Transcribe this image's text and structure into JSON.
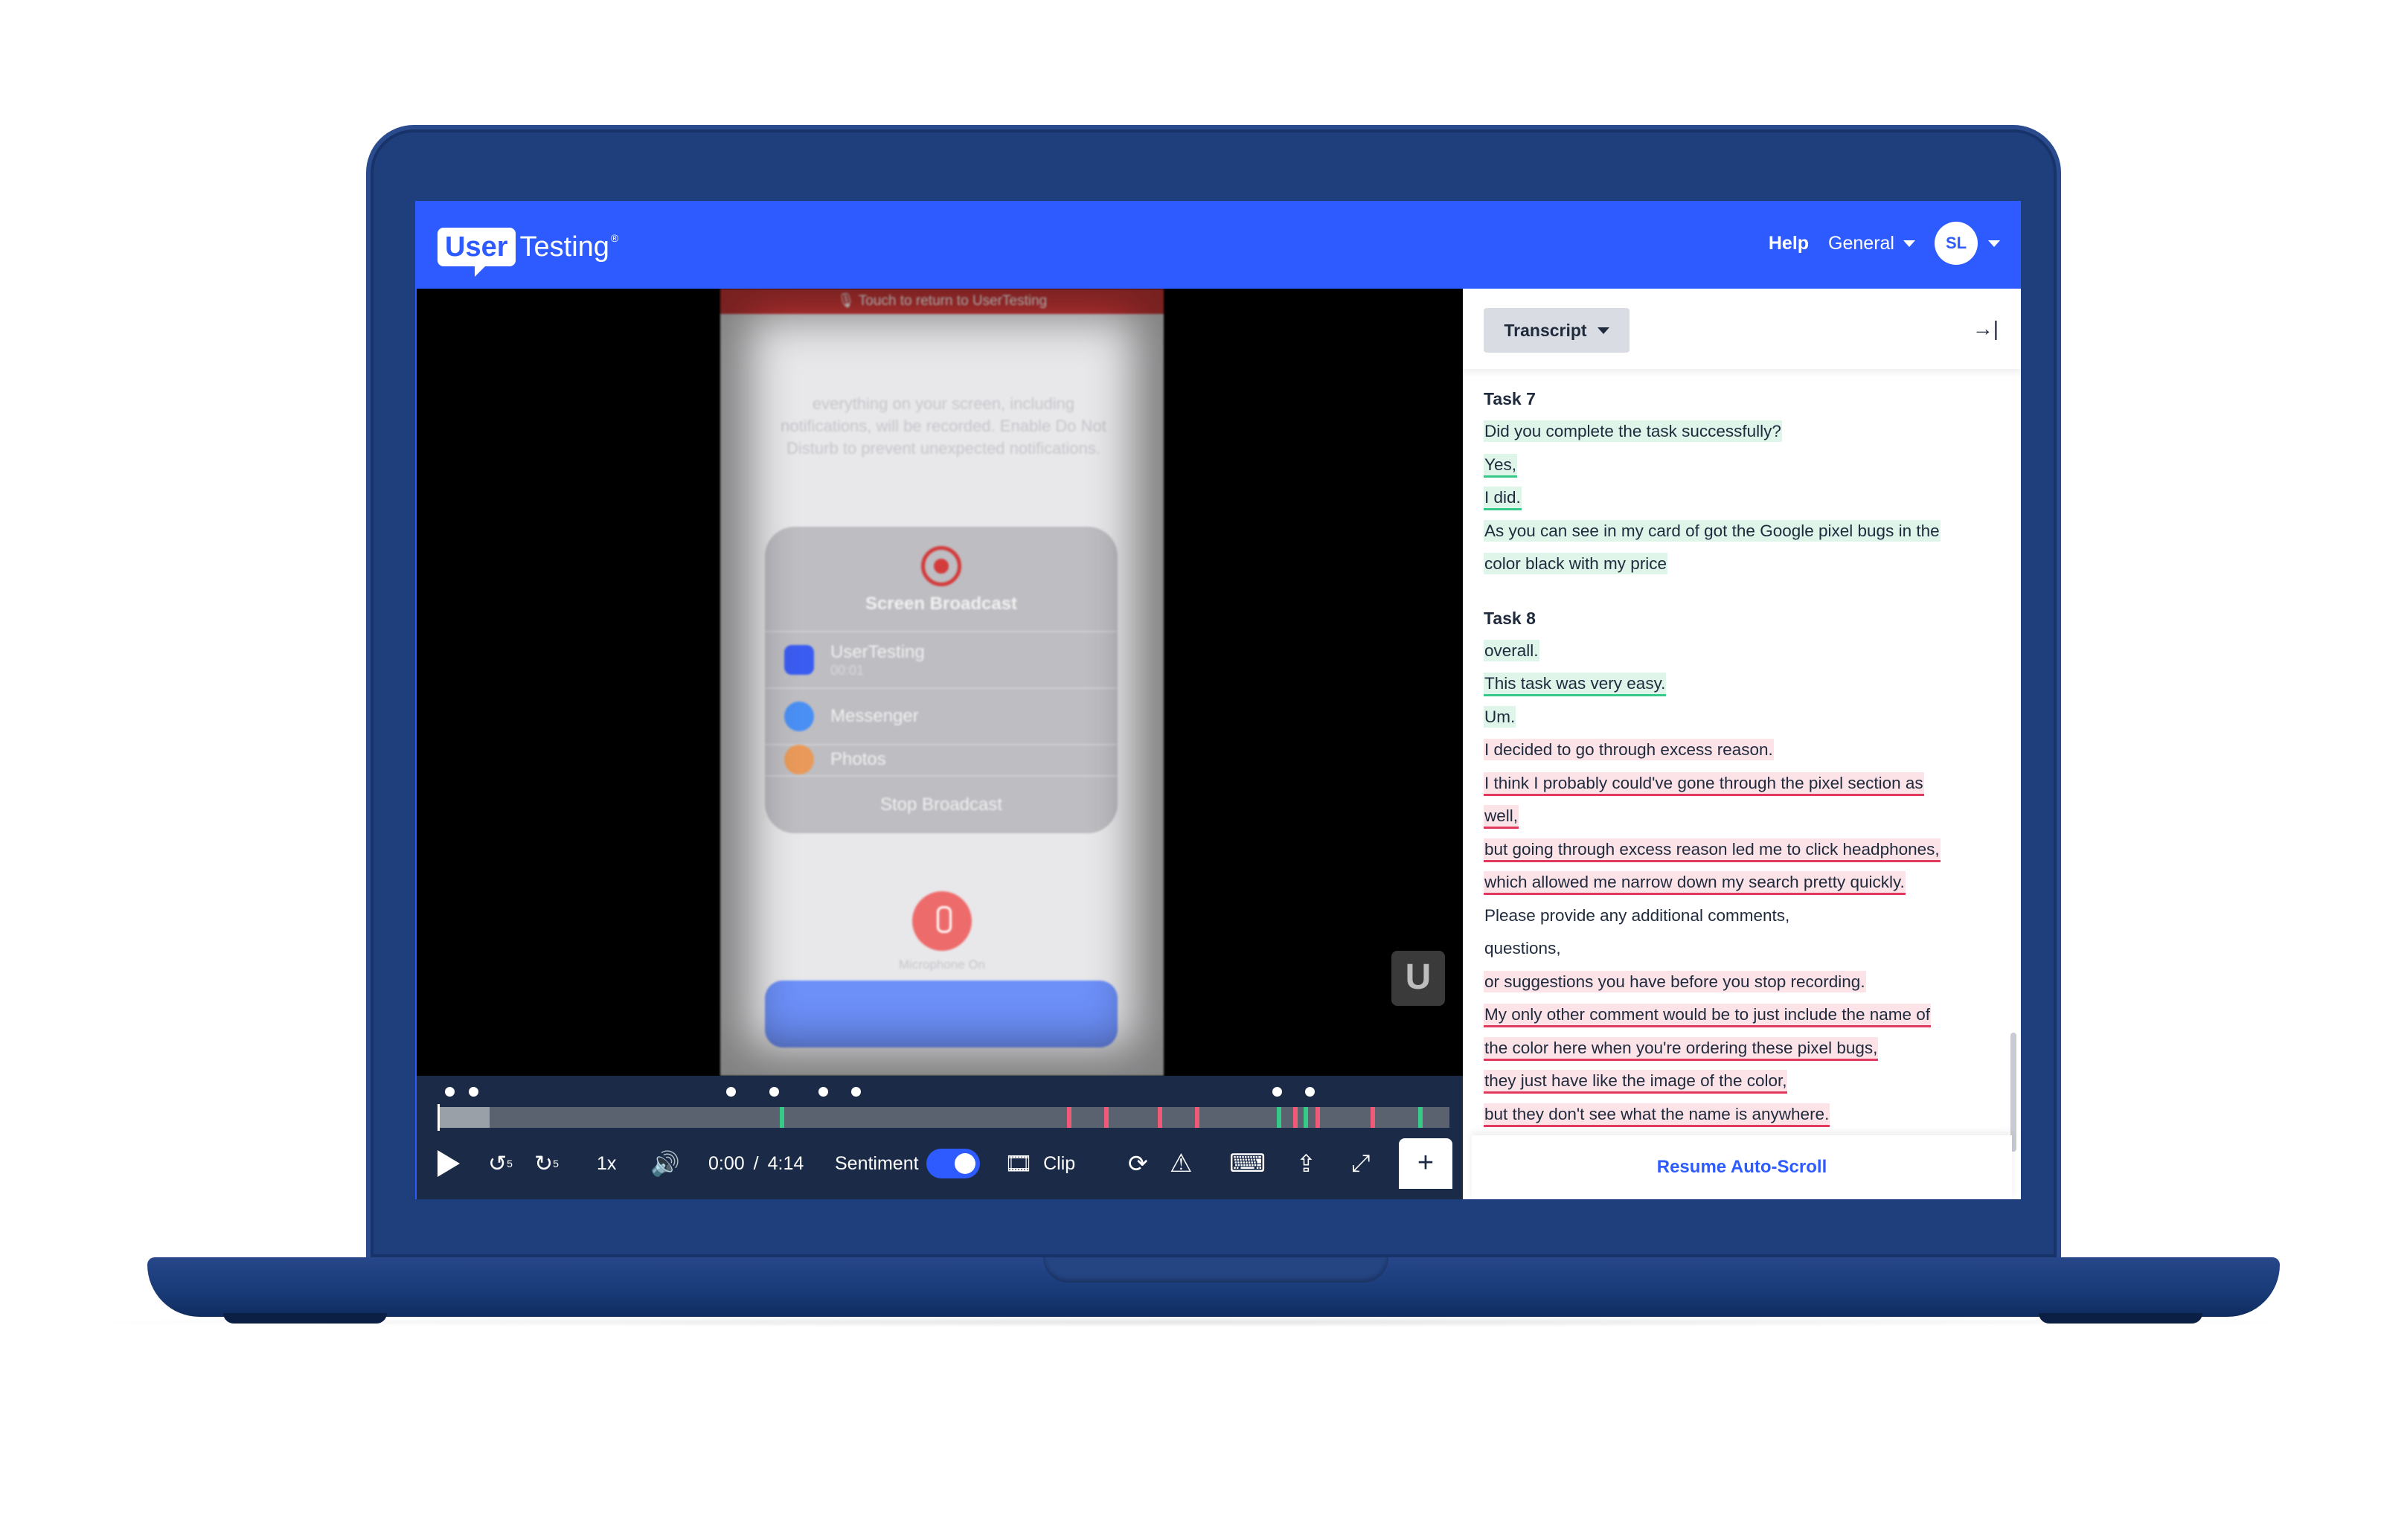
{
  "header": {
    "logo_user": "User",
    "logo_testing": "Testing",
    "logo_reg": "®",
    "help": "Help",
    "workspace": "General",
    "avatar_initials": "SL"
  },
  "phone": {
    "banner": "🎙 Touch to return to UserTesting",
    "background_text": "everything on your screen, including notifications, will be recorded. Enable Do Not Disturb to prevent unexpected notifications.",
    "broadcast_title": "Screen Broadcast",
    "apps": [
      {
        "name": "UserTesting",
        "time": "00:01"
      },
      {
        "name": "Messenger"
      },
      {
        "name": "Photos"
      }
    ],
    "stop": "Stop Broadcast",
    "mic_label": "Microphone On"
  },
  "watermark": "U",
  "player": {
    "speed": "1x",
    "current_time": "0:00",
    "separator": "/",
    "duration": "4:14",
    "sentiment_label": "Sentiment",
    "sentiment_on": true,
    "clip_label": "Clip",
    "add_label": "+",
    "rewind_seconds": "5",
    "forward_seconds": "5"
  },
  "transcript": {
    "dropdown": "Transcript",
    "collapse_icon": "→|",
    "task7": "Task 7",
    "task7_lines": [
      "Did you complete the task successfully?",
      "Yes,",
      "I did.",
      "As you can see in my card of got the Google pixel bugs in the",
      "color black with my price"
    ],
    "task8": "Task 8",
    "task8_lines": [
      "overall.",
      "This task was very easy.",
      "Um.",
      "I decided to go through excess reason.",
      "I think I probably could've gone through the pixel section as",
      "well,",
      "but going through excess reason led me to click headphones,",
      "which allowed me narrow down my search pretty quickly.",
      "Please provide any additional comments,",
      "questions,",
      "or suggestions you have before you stop recording.",
      "My only other comment would be to just include the name of",
      "the color here when you're ordering these pixel bugs,",
      "they just have like the image of the color,",
      "but they don't see what the name is anywhere."
    ],
    "resume": "Resume Auto-Scroll"
  },
  "colors": {
    "brand_blue": "#2d5bff",
    "positive": "#37c98a",
    "negative": "#e23a5e",
    "laptop": "#1f3f7c"
  }
}
